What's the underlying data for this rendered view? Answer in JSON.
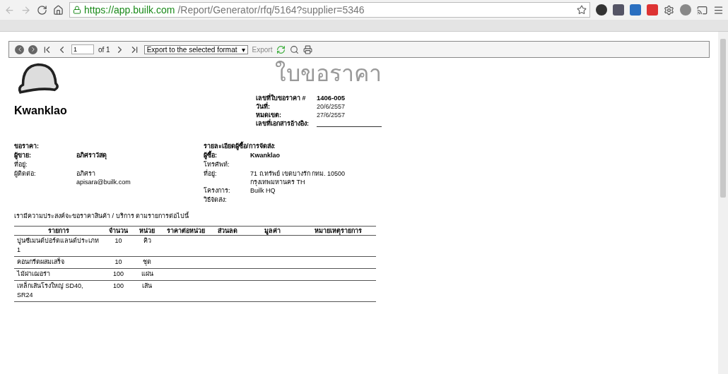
{
  "browser": {
    "url_host": "https://app.builk.com",
    "url_path": "/Report/Generator/rfq/5164?supplier=5346"
  },
  "toolbar": {
    "page": "1",
    "page_of": "of 1",
    "format": "Export to the selected format",
    "format_caret": "▾",
    "export": "Export"
  },
  "document": {
    "company": "Kwanklao",
    "title": "ใบขอราคา",
    "meta": [
      {
        "label": "เลขที่ใบขอราคา #",
        "value": "1406-005",
        "bold": true
      },
      {
        "label": "วันที่:",
        "value": "20/6/2557",
        "bold": false
      },
      {
        "label": "หมดเขต:",
        "value": "27/6/2557",
        "bold": false
      },
      {
        "label": "เลขที่เอกสารอ้างอิง:"
      }
    ],
    "left_heading": "ขอราคา:",
    "left_rows": [
      {
        "label": "ผู้ขาย:",
        "lines": [
          "อภิศราวัสดุ"
        ],
        "bold": true
      },
      {
        "label": "ที่อยู่:",
        "lines": [],
        "bold": false
      },
      {
        "label": "ผู้ติดต่อ:",
        "lines": [
          "อภิศรา",
          "apisara@builk.com"
        ],
        "bold": false
      }
    ],
    "right_heading": "รายละเอียดผู้ซื้อ/การจัดส่ง:",
    "right_rows": [
      {
        "label": "ผู้ซื้อ:",
        "lines": [
          "Kwanklao"
        ],
        "bold": true
      },
      {
        "label": "โทรศัพท์:",
        "lines": [],
        "bold": false
      },
      {
        "label": "ที่อยู่:",
        "lines": [
          "71 ถ.ทรัพย์ เขตบางรัก กทม. 10500",
          "กรุงเทพมหานคร TH"
        ],
        "bold": false
      },
      {
        "label": "โครงการ:",
        "lines": [
          "Builk HQ"
        ],
        "bold": false
      },
      {
        "label": "วิธีจัดส่ง:",
        "lines": [],
        "bold": false
      }
    ],
    "intro": "เรามีความประสงค์จะขอราคาสินค้า / บริการ ตามรายการต่อไปนี้",
    "table": {
      "columns": [
        "รายการ",
        "จำนวน",
        "หน่วย",
        "ราคาต่อหน่วย",
        "ส่วนลด",
        "มูลค่า",
        "หมายเหตุรายการ"
      ],
      "rows": [
        [
          "ปูนซีเมนต์ปอร์ตแลนด์ประเภท 1",
          "10",
          "คิว"
        ],
        [
          "คอนกรีตผสมเสร็จ",
          "10",
          "ชุด"
        ],
        [
          "ไม้ฝาเฌอร่า",
          "100",
          "แผ่น"
        ],
        [
          "เหล็กเส้นโรงใหญ่ SD40, SR24",
          "100",
          "เส้น"
        ]
      ]
    }
  }
}
